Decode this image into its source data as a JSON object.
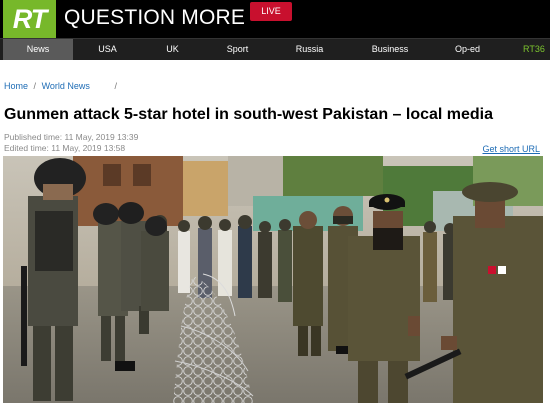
{
  "header": {
    "logo": "RT",
    "tagline": "QUESTION MORE",
    "live_label": "LIVE"
  },
  "nav": {
    "items": [
      {
        "label": "News"
      },
      {
        "label": "USA"
      },
      {
        "label": "UK"
      },
      {
        "label": "Sport"
      },
      {
        "label": "Russia"
      },
      {
        "label": "Business"
      },
      {
        "label": "Op-ed"
      },
      {
        "label": "RT36"
      }
    ]
  },
  "breadcrumb": {
    "home": "Home",
    "section": "World News",
    "separator": "/"
  },
  "article": {
    "title": "Gunmen attack 5-star hotel in south-west Pakistan – local media",
    "published": "Published time: 11 May, 2019 13:39",
    "edited": "Edited time: 11 May, 2019 13:58",
    "short_url_label": "Get short URL"
  },
  "colors": {
    "brand_green": "#77b82a",
    "live_red": "#c8102e",
    "link_blue": "#1e6cb5"
  }
}
